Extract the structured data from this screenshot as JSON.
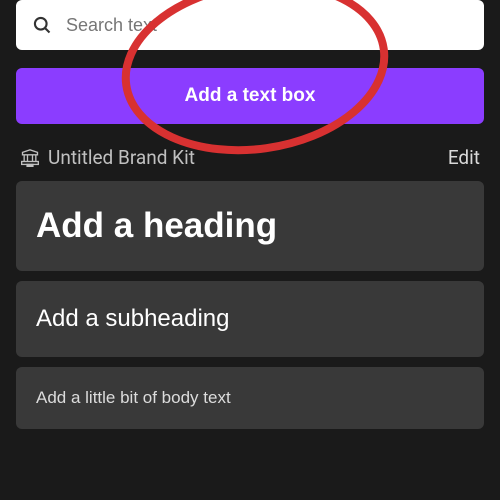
{
  "search": {
    "placeholder": "Search text"
  },
  "buttons": {
    "add_text_box": "Add a text box"
  },
  "brand_kit": {
    "label": "Untitled Brand Kit",
    "edit": "Edit"
  },
  "text_styles": {
    "heading": "Add a heading",
    "subheading": "Add a subheading",
    "body": "Add a little bit of body text"
  },
  "colors": {
    "accent": "#8b3dff",
    "panel_bg": "#1a1a1a",
    "card_bg": "#393939",
    "annotation": "#d83131"
  }
}
